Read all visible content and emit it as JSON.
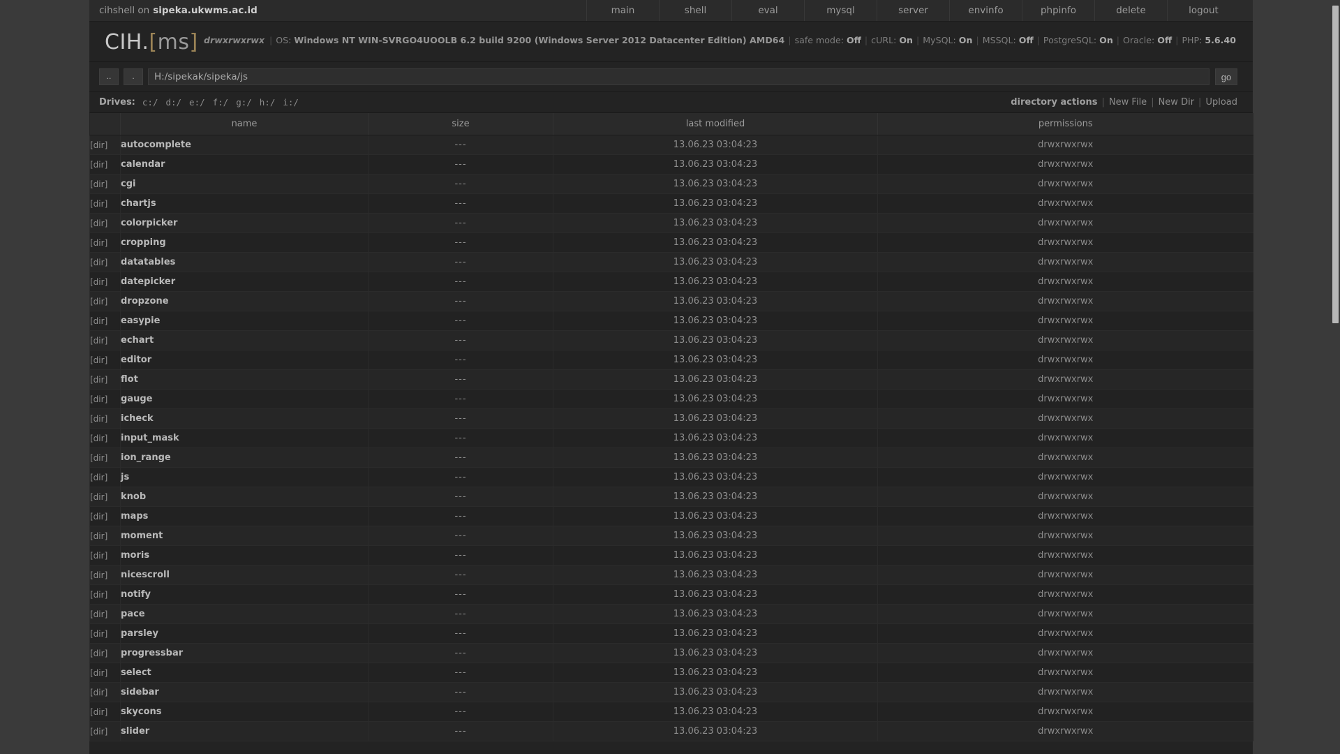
{
  "topbar": {
    "user_prefix": "cihshell on",
    "host": "sipeka.ukwms.ac.id",
    "nav": [
      {
        "label": "main"
      },
      {
        "label": "shell"
      },
      {
        "label": "eval"
      },
      {
        "label": "mysql"
      },
      {
        "label": "server"
      },
      {
        "label": "envinfo"
      },
      {
        "label": "phpinfo"
      },
      {
        "label": "delete"
      },
      {
        "label": "logout"
      }
    ]
  },
  "logo": {
    "text_main": "CIH.",
    "bracket_open": "[",
    "text_ms": "ms",
    "bracket_close": "]"
  },
  "sysinfo": {
    "permissions": "drwxrwxrwx",
    "os_label": "OS:",
    "os_value": "Windows NT WIN-SVRGO4UOOLB 6.2 build 9200 (Windows Server 2012 Datacenter Edition) AMD64",
    "safe_mode_label": "safe mode:",
    "safe_mode_value": "Off",
    "curl_label": "cURL:",
    "curl_value": "On",
    "mysql_label": "MySQL:",
    "mysql_value": "On",
    "mssql_label": "MSSQL:",
    "mssql_value": "Off",
    "postgresql_label": "PostgreSQL:",
    "postgresql_value": "On",
    "oracle_label": "Oracle:",
    "oracle_value": "Off",
    "php_label": "PHP:",
    "php_value": "5.6.40"
  },
  "pathbar": {
    "up_button": "..",
    "here_button": ".",
    "path_value": "H:/sipekak/sipeka/js",
    "go_button": "go"
  },
  "drives": {
    "label": "Drives:",
    "items": [
      "c:/",
      "d:/",
      "e:/",
      "f:/",
      "g:/",
      "h:/",
      "i:/"
    ]
  },
  "directory_actions": {
    "label": "directory actions",
    "items": [
      "New File",
      "New Dir",
      "Upload"
    ]
  },
  "table": {
    "headers": {
      "type": "",
      "name": "name",
      "size": "size",
      "last_modified": "last modified",
      "permissions": "permissions"
    },
    "rows": [
      {
        "type": "[dir]",
        "name": "autocomplete",
        "size": "---",
        "modified": "13.06.23 03:04:23",
        "perm": "drwxrwxrwx"
      },
      {
        "type": "[dir]",
        "name": "calendar",
        "size": "---",
        "modified": "13.06.23 03:04:23",
        "perm": "drwxrwxrwx"
      },
      {
        "type": "[dir]",
        "name": "cgi",
        "size": "---",
        "modified": "13.06.23 03:04:23",
        "perm": "drwxrwxrwx"
      },
      {
        "type": "[dir]",
        "name": "chartjs",
        "size": "---",
        "modified": "13.06.23 03:04:23",
        "perm": "drwxrwxrwx"
      },
      {
        "type": "[dir]",
        "name": "colorpicker",
        "size": "---",
        "modified": "13.06.23 03:04:23",
        "perm": "drwxrwxrwx"
      },
      {
        "type": "[dir]",
        "name": "cropping",
        "size": "---",
        "modified": "13.06.23 03:04:23",
        "perm": "drwxrwxrwx"
      },
      {
        "type": "[dir]",
        "name": "datatables",
        "size": "---",
        "modified": "13.06.23 03:04:23",
        "perm": "drwxrwxrwx"
      },
      {
        "type": "[dir]",
        "name": "datepicker",
        "size": "---",
        "modified": "13.06.23 03:04:23",
        "perm": "drwxrwxrwx"
      },
      {
        "type": "[dir]",
        "name": "dropzone",
        "size": "---",
        "modified": "13.06.23 03:04:23",
        "perm": "drwxrwxrwx"
      },
      {
        "type": "[dir]",
        "name": "easypie",
        "size": "---",
        "modified": "13.06.23 03:04:23",
        "perm": "drwxrwxrwx"
      },
      {
        "type": "[dir]",
        "name": "echart",
        "size": "---",
        "modified": "13.06.23 03:04:23",
        "perm": "drwxrwxrwx"
      },
      {
        "type": "[dir]",
        "name": "editor",
        "size": "---",
        "modified": "13.06.23 03:04:23",
        "perm": "drwxrwxrwx"
      },
      {
        "type": "[dir]",
        "name": "flot",
        "size": "---",
        "modified": "13.06.23 03:04:23",
        "perm": "drwxrwxrwx"
      },
      {
        "type": "[dir]",
        "name": "gauge",
        "size": "---",
        "modified": "13.06.23 03:04:23",
        "perm": "drwxrwxrwx"
      },
      {
        "type": "[dir]",
        "name": "icheck",
        "size": "---",
        "modified": "13.06.23 03:04:23",
        "perm": "drwxrwxrwx"
      },
      {
        "type": "[dir]",
        "name": "input_mask",
        "size": "---",
        "modified": "13.06.23 03:04:23",
        "perm": "drwxrwxrwx"
      },
      {
        "type": "[dir]",
        "name": "ion_range",
        "size": "---",
        "modified": "13.06.23 03:04:23",
        "perm": "drwxrwxrwx"
      },
      {
        "type": "[dir]",
        "name": "js",
        "size": "---",
        "modified": "13.06.23 03:04:23",
        "perm": "drwxrwxrwx"
      },
      {
        "type": "[dir]",
        "name": "knob",
        "size": "---",
        "modified": "13.06.23 03:04:23",
        "perm": "drwxrwxrwx"
      },
      {
        "type": "[dir]",
        "name": "maps",
        "size": "---",
        "modified": "13.06.23 03:04:23",
        "perm": "drwxrwxrwx"
      },
      {
        "type": "[dir]",
        "name": "moment",
        "size": "---",
        "modified": "13.06.23 03:04:23",
        "perm": "drwxrwxrwx"
      },
      {
        "type": "[dir]",
        "name": "moris",
        "size": "---",
        "modified": "13.06.23 03:04:23",
        "perm": "drwxrwxrwx"
      },
      {
        "type": "[dir]",
        "name": "nicescroll",
        "size": "---",
        "modified": "13.06.23 03:04:23",
        "perm": "drwxrwxrwx"
      },
      {
        "type": "[dir]",
        "name": "notify",
        "size": "---",
        "modified": "13.06.23 03:04:23",
        "perm": "drwxrwxrwx"
      },
      {
        "type": "[dir]",
        "name": "pace",
        "size": "---",
        "modified": "13.06.23 03:04:23",
        "perm": "drwxrwxrwx"
      },
      {
        "type": "[dir]",
        "name": "parsley",
        "size": "---",
        "modified": "13.06.23 03:04:23",
        "perm": "drwxrwxrwx"
      },
      {
        "type": "[dir]",
        "name": "progressbar",
        "size": "---",
        "modified": "13.06.23 03:04:23",
        "perm": "drwxrwxrwx"
      },
      {
        "type": "[dir]",
        "name": "select",
        "size": "---",
        "modified": "13.06.23 03:04:23",
        "perm": "drwxrwxrwx"
      },
      {
        "type": "[dir]",
        "name": "sidebar",
        "size": "---",
        "modified": "13.06.23 03:04:23",
        "perm": "drwxrwxrwx"
      },
      {
        "type": "[dir]",
        "name": "skycons",
        "size": "---",
        "modified": "13.06.23 03:04:23",
        "perm": "drwxrwxrwx"
      },
      {
        "type": "[dir]",
        "name": "slider",
        "size": "---",
        "modified": "13.06.23 03:04:23",
        "perm": "drwxrwxrwx"
      }
    ]
  }
}
